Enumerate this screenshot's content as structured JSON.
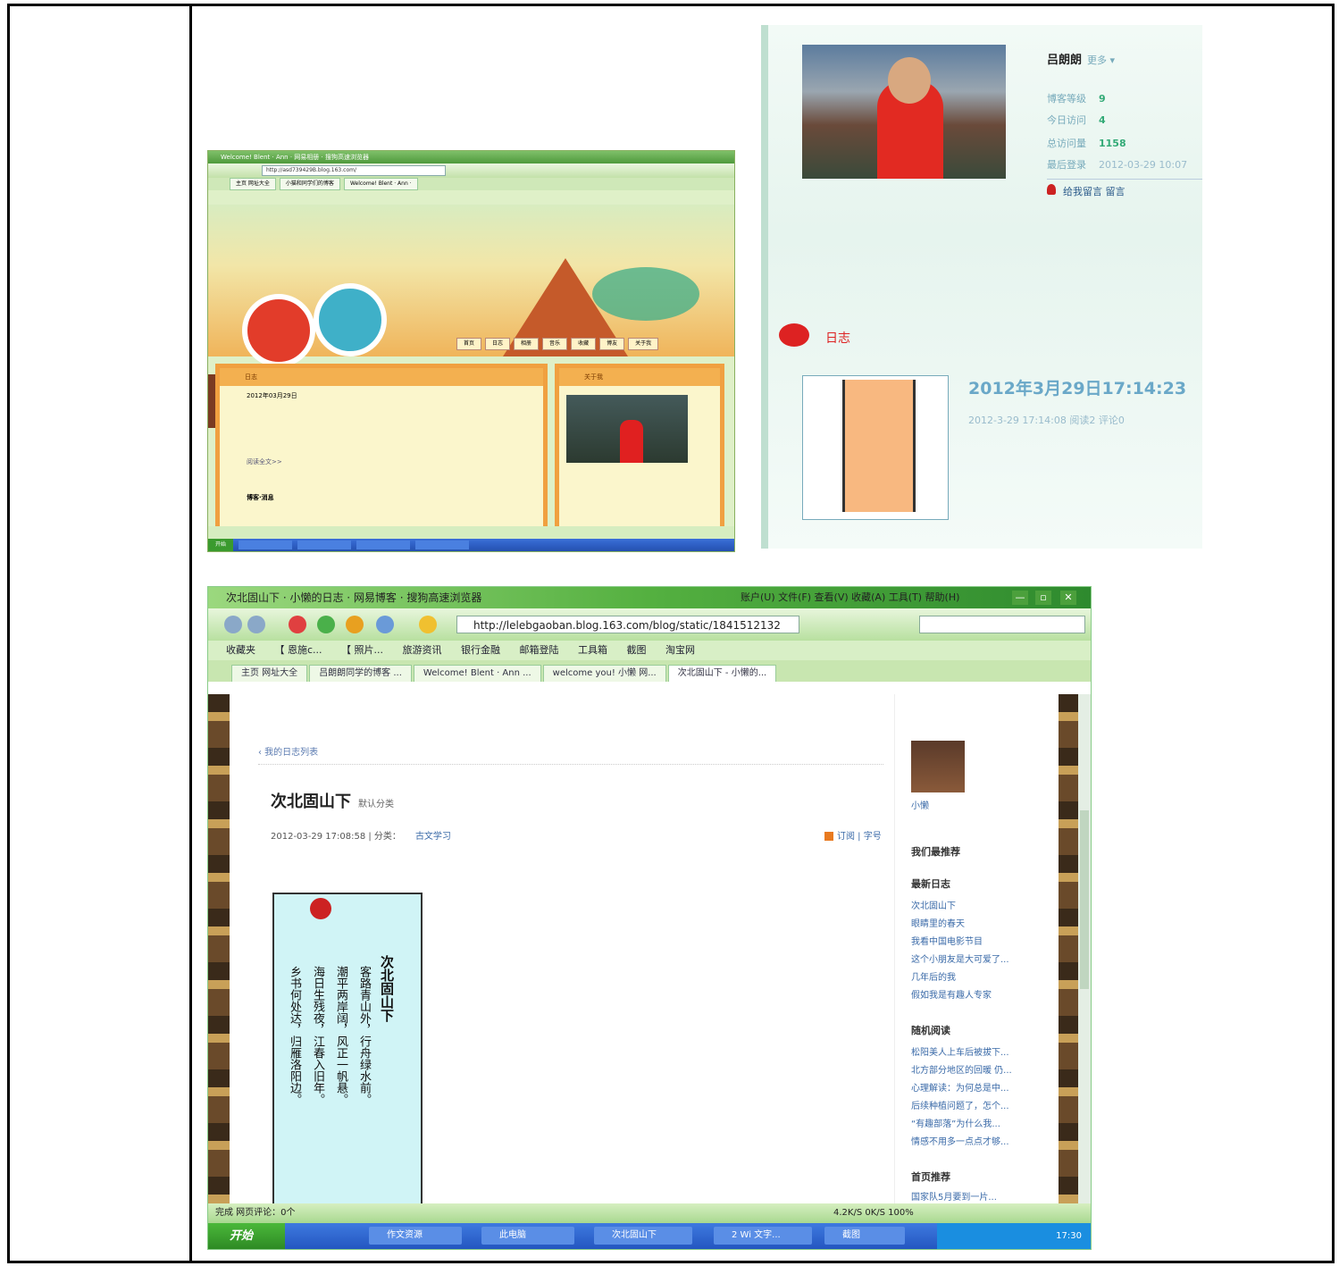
{
  "screenshot_small": {
    "window_title": "Welcome! Blent · Ann · 网易相册 · 搜狗高速浏览器",
    "url": "http://asd739429B.blog.163.com/",
    "tabs": [
      "主页 网址大全",
      "小猫和同学们的博客",
      "Welcome! Blent · Ann ·"
    ],
    "nav": [
      "首页",
      "日志",
      "相册",
      "音乐",
      "收藏",
      "博友",
      "关于我"
    ],
    "left_panel_title": "日志",
    "left_post_date": "2012年03月29日",
    "left_post_more": "阅读全文>>",
    "left_post_section": "博客·消息",
    "right_panel_title": "关于我",
    "start_label": "开始"
  },
  "profile": {
    "name": "吕朗朗",
    "more": "更多 ▾",
    "stats": [
      {
        "label": "博客等级",
        "value": "9"
      },
      {
        "label": "今日访问",
        "value": "4"
      },
      {
        "label": "总访问量",
        "value": "1158"
      },
      {
        "label": "最后登录",
        "value": "2012-03-29 10:07"
      }
    ],
    "message_link": "给我留言 留言",
    "diary_label": "日志",
    "post_date": "2012年3月29日17:14:23",
    "post_meta": "2012-3-29 17:14:08   阅读2   评论0"
  },
  "browser": {
    "window_title": "次北固山下 · 小懒的日志 · 网易博客 · 搜狗高速浏览器",
    "menu": "账户(U)  文件(F)  查看(V)  收藏(A)  工具(T)  帮助(H)",
    "window_buttons": [
      "—",
      "▫",
      "✕"
    ],
    "url": "http://lelebgaoban.blog.163.com/blog/static/1841512132",
    "favorites": [
      "收藏夹",
      "【 恩施c...",
      "【 照片...",
      "旅游资讯",
      "银行金融",
      "邮箱登陆",
      "工具箱",
      "截图",
      "淘宝网"
    ],
    "tabs": [
      "主页 网址大全",
      "吕朗朗同学的博客 ...",
      "Welcome! Blent · Ann ...",
      "welcome you! 小懒 网...",
      "次北固山下 - 小懒的..."
    ],
    "active_tab_index": 4,
    "back_link": "‹ 我的日志列表",
    "post_title": "次北固山下",
    "post_title_tag": "默认分类",
    "post_meta": "2012-03-29 17:08:58 | 分类：",
    "post_category": "古文学习",
    "share_label": "订阅 | 字号",
    "poem_lines": [
      "次北固山下",
      "客路青山外，行舟绿水前。",
      "潮平两岸阔，风正一帆悬。",
      "海日生残夜，江春入旧年。",
      "乡书何处达，归雁洛阳边。"
    ],
    "sidebar": {
      "user": "小懒",
      "section_recommend": "我们最推荐",
      "section_latest": "最新日志",
      "latest": [
        "次北固山下",
        "眼睛里的春天",
        "我看中国电影节目",
        "这个小朋友是大可爱了...",
        "几年后的我",
        "假如我是有趣人专家"
      ],
      "section_random": "随机阅读",
      "random": [
        "松阳美人上车后被拔下...",
        "北方部分地区的回暖 仍...",
        "心理解读：为何总是中...",
        "后续种植问题了，怎个...",
        "“有趣部落”为什么我...",
        "情感不用多一点点才够..."
      ],
      "section_home": "首页推荐",
      "home": [
        "国家队5月要到一片..."
      ]
    },
    "status_left": "完成  网页评论：0个",
    "status_right": "4.2K/S  0K/S  100%",
    "taskbar": {
      "start": "开始",
      "buttons": [
        "作文资源",
        "此电脑",
        "次北固山下",
        "2 Wi 文字...",
        "截图"
      ],
      "clock": "17:30"
    }
  }
}
